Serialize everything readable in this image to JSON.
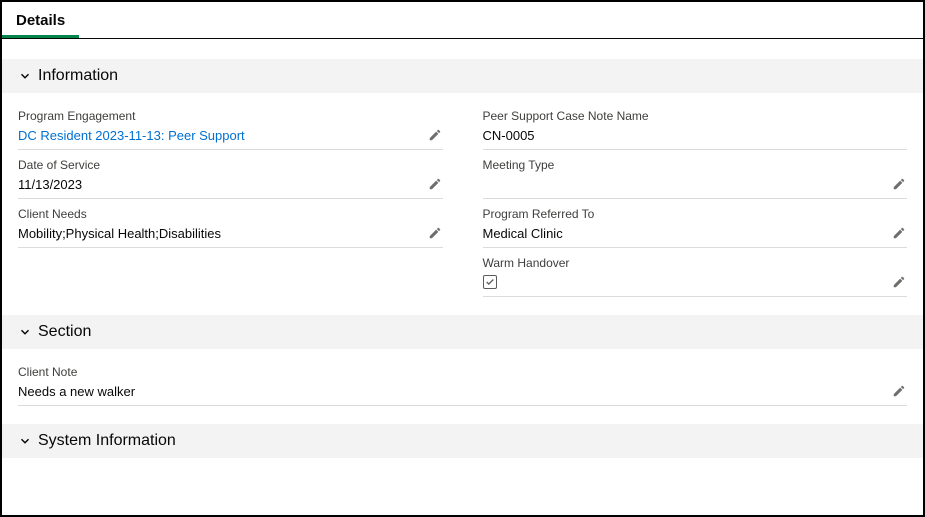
{
  "tabs": {
    "details": "Details"
  },
  "sections": {
    "information": {
      "title": "Information"
    },
    "section": {
      "title": "Section"
    },
    "system": {
      "title": "System Information"
    }
  },
  "fields": {
    "program_engagement": {
      "label": "Program Engagement",
      "value": "DC Resident 2023-11-13: Peer Support"
    },
    "date_of_service": {
      "label": "Date of Service",
      "value": "11/13/2023"
    },
    "client_needs": {
      "label": "Client Needs",
      "value": "Mobility;Physical Health;Disabilities"
    },
    "case_note_name": {
      "label": "Peer Support Case Note Name",
      "value": "CN-0005"
    },
    "meeting_type": {
      "label": "Meeting Type",
      "value": ""
    },
    "program_referred": {
      "label": "Program Referred To",
      "value": "Medical Clinic"
    },
    "warm_handover": {
      "label": "Warm Handover",
      "checked": true
    },
    "client_note": {
      "label": "Client Note",
      "value": "Needs a new walker"
    }
  }
}
